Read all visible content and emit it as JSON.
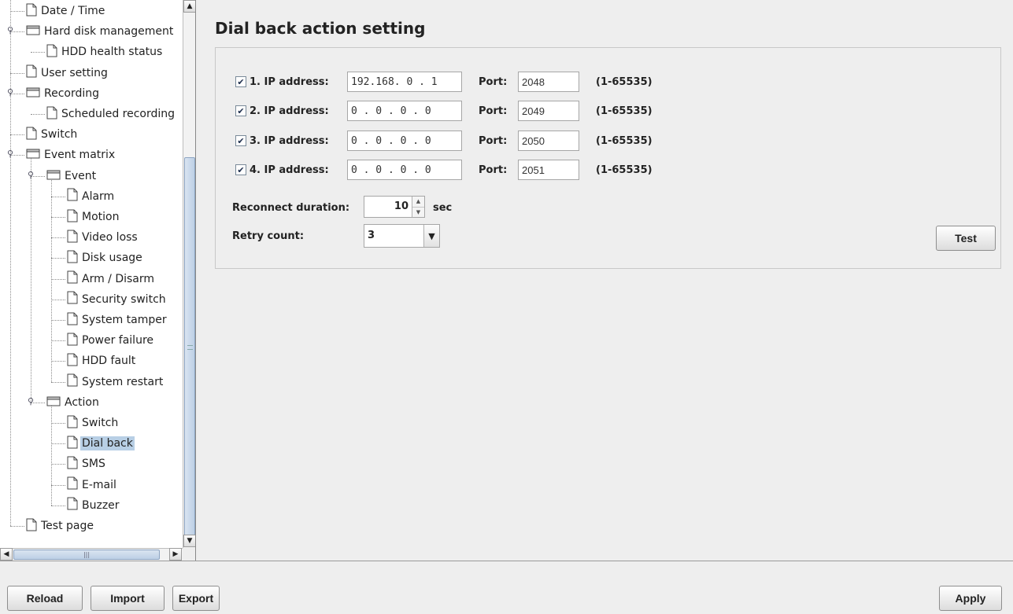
{
  "tree": {
    "items": [
      {
        "label": "Date / Time",
        "icon": "file-icon"
      },
      {
        "label": "Hard disk management",
        "icon": "folder-icon"
      },
      {
        "label": "HDD health status",
        "icon": "file-icon"
      },
      {
        "label": "User setting",
        "icon": "file-icon"
      },
      {
        "label": "Recording",
        "icon": "folder-icon"
      },
      {
        "label": "Scheduled recording",
        "icon": "file-icon"
      },
      {
        "label": "Switch",
        "icon": "file-icon"
      },
      {
        "label": "Event matrix",
        "icon": "folder-icon"
      },
      {
        "label": "Event",
        "icon": "folder-icon"
      },
      {
        "label": "Alarm",
        "icon": "file-icon"
      },
      {
        "label": "Motion",
        "icon": "file-icon"
      },
      {
        "label": "Video loss",
        "icon": "file-icon"
      },
      {
        "label": "Disk usage",
        "icon": "file-icon"
      },
      {
        "label": "Arm / Disarm",
        "icon": "file-icon"
      },
      {
        "label": "Security switch",
        "icon": "file-icon"
      },
      {
        "label": "System tamper",
        "icon": "file-icon"
      },
      {
        "label": "Power failure",
        "icon": "file-icon"
      },
      {
        "label": "HDD fault",
        "icon": "file-icon"
      },
      {
        "label": "System restart",
        "icon": "file-icon"
      },
      {
        "label": "Action",
        "icon": "folder-icon"
      },
      {
        "label": "Switch",
        "icon": "file-icon"
      },
      {
        "label": "Dial back",
        "icon": "file-icon",
        "selected": true
      },
      {
        "label": "SMS",
        "icon": "file-icon"
      },
      {
        "label": "E-mail",
        "icon": "file-icon"
      },
      {
        "label": "Buzzer",
        "icon": "file-icon"
      },
      {
        "label": "Test page",
        "icon": "file-icon"
      }
    ]
  },
  "main": {
    "title": "Dial back action setting",
    "ip_rows": [
      {
        "label": "1. IP address:",
        "checked": true,
        "ip": "192.168. 0 . 1",
        "port_label": "Port:",
        "port": "2048",
        "range": "(1-65535)"
      },
      {
        "label": "2. IP address:",
        "checked": true,
        "ip": "0 . 0 . 0 . 0",
        "port_label": "Port:",
        "port": "2049",
        "range": "(1-65535)"
      },
      {
        "label": "3. IP address:",
        "checked": true,
        "ip": "0 . 0 . 0 . 0",
        "port_label": "Port:",
        "port": "2050",
        "range": "(1-65535)"
      },
      {
        "label": "4. IP address:",
        "checked": true,
        "ip": "0 . 0 . 0 . 0",
        "port_label": "Port:",
        "port": "2051",
        "range": "(1-65535)"
      }
    ],
    "reconnect_label": "Reconnect duration:",
    "reconnect_value": "10",
    "reconnect_unit": "sec",
    "retry_label": "Retry count:",
    "retry_value": "3",
    "test_button": "Test"
  },
  "footer": {
    "reload": "Reload",
    "import": "Import",
    "export": "Export",
    "apply": "Apply"
  },
  "colors": {
    "selection": "#b8cfe5",
    "background": "#eeeeee"
  }
}
